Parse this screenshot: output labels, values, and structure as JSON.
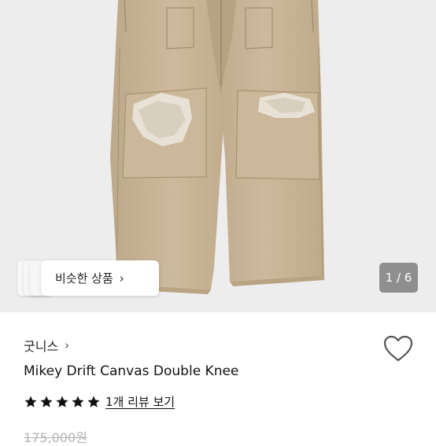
{
  "gallery": {
    "image_alt": "Mikey Drift Canvas Double Knee",
    "similar_label": "비슷한 상품",
    "chevron": "›",
    "counter": "1 / 6"
  },
  "shop": {
    "name": "굿니스",
    "chevron": "›"
  },
  "product": {
    "title": "Mikey Drift Canvas Double Knee",
    "stars": 5,
    "review_link": "1개 리뷰 보기",
    "original_price": "175,000원"
  },
  "icons": {
    "heart": "heart-outline-icon",
    "star": "star-filled-icon"
  },
  "colors": {
    "pants": "#c9b597",
    "background": "#ededed",
    "counter_bg": "#8f8f8f"
  }
}
